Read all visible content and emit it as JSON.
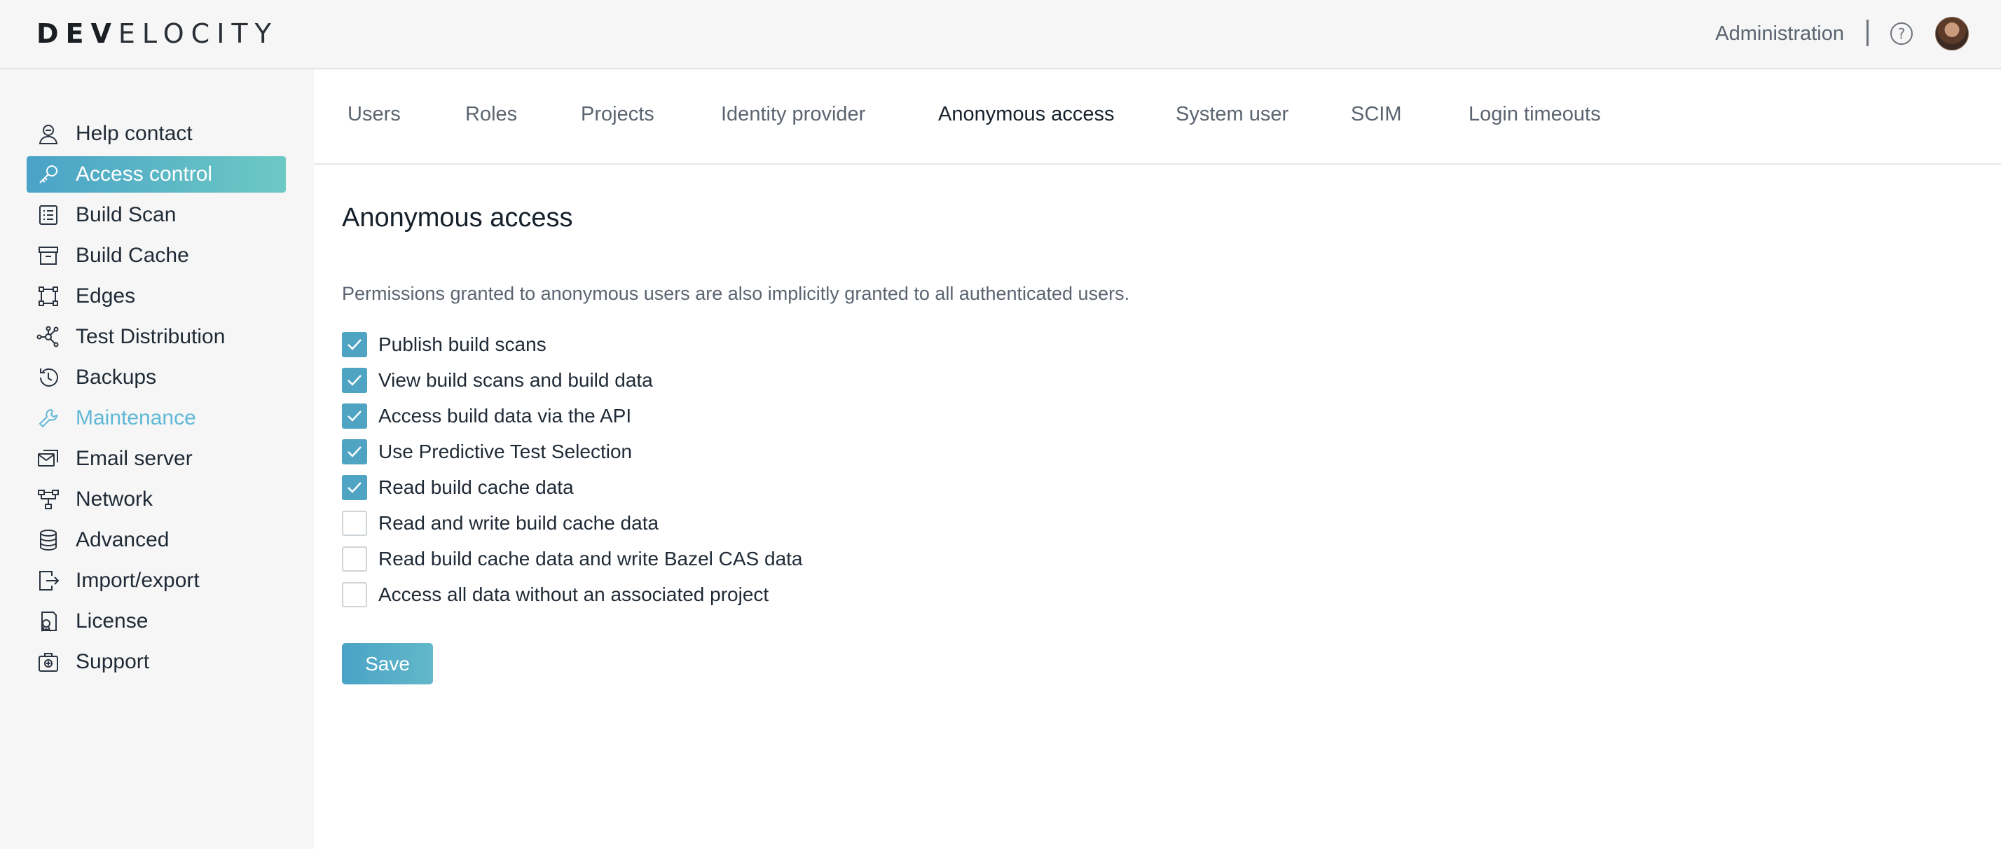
{
  "header": {
    "logo_bold": "DEV",
    "logo_rest": "ELOCITY",
    "admin_label": "Administration",
    "help_icon": "question-circle-icon",
    "avatar_icon": "user-avatar"
  },
  "sidebar": {
    "items": [
      {
        "label": "Help contact",
        "icon": "contact-icon"
      },
      {
        "label": "Access control",
        "icon": "key-icon",
        "active": true
      },
      {
        "label": "Build Scan",
        "icon": "list-icon"
      },
      {
        "label": "Build Cache",
        "icon": "archive-icon"
      },
      {
        "label": "Edges",
        "icon": "edges-icon"
      },
      {
        "label": "Test Distribution",
        "icon": "distribution-icon"
      },
      {
        "label": "Backups",
        "icon": "history-icon"
      },
      {
        "label": "Maintenance",
        "icon": "wrench-icon"
      },
      {
        "label": "Email server",
        "icon": "email-icon"
      },
      {
        "label": "Network",
        "icon": "network-icon"
      },
      {
        "label": "Advanced",
        "icon": "database-icon"
      },
      {
        "label": "Import/export",
        "icon": "import-export-icon"
      },
      {
        "label": "License",
        "icon": "license-icon"
      },
      {
        "label": "Support",
        "icon": "support-icon"
      }
    ]
  },
  "tabs": [
    {
      "label": "Users"
    },
    {
      "label": "Roles"
    },
    {
      "label": "Projects"
    },
    {
      "label": "Identity provider"
    },
    {
      "label": "Anonymous access",
      "active": true
    },
    {
      "label": "System user"
    },
    {
      "label": "SCIM"
    },
    {
      "label": "Login timeouts"
    }
  ],
  "content": {
    "title": "Anonymous access",
    "description": "Permissions granted to anonymous users are also implicitly granted to all authenticated users.",
    "permissions": [
      {
        "label": "Publish build scans",
        "checked": true
      },
      {
        "label": "View build scans and build data",
        "checked": true
      },
      {
        "label": "Access build data via the API",
        "checked": true
      },
      {
        "label": "Use Predictive Test Selection",
        "checked": true
      },
      {
        "label": "Read build cache data",
        "checked": true
      },
      {
        "label": "Read and write build cache data",
        "checked": false
      },
      {
        "label": "Read build cache data and write Bazel CAS data",
        "checked": false
      },
      {
        "label": "Access all data without an associated project",
        "checked": false
      }
    ],
    "save_label": "Save"
  },
  "colors": {
    "accent": "#4ea4c2",
    "active_gradient_start": "#4aa3c7",
    "active_gradient_end": "#6cc9c4",
    "muted_link": "#5fb8d6"
  }
}
